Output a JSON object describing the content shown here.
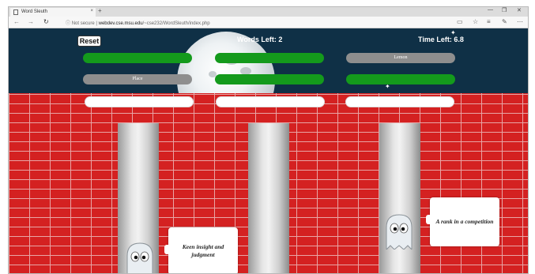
{
  "browser": {
    "tab_title": "Word Sleuth",
    "tab_close": "×",
    "new_tab": "+",
    "nav_back": "←",
    "nav_forward": "→",
    "nav_reload": "↻",
    "security": "Not secure",
    "address_host": "webdev.cse.msu.edu",
    "address_path": "/~cse232/WordSleuth/index.php",
    "window_minimize": "—",
    "window_restore": "❐",
    "window_close": "✕"
  },
  "game": {
    "reset_label": "Reset",
    "words_left_label": "Words Left: 2",
    "time_left_label": "Time Left: 6.8",
    "word_slots": [
      {
        "label": "",
        "state": "green"
      },
      {
        "label": "",
        "state": "green"
      },
      {
        "label": "Lemon",
        "state": "grey"
      },
      {
        "label": "Place",
        "state": "grey"
      },
      {
        "label": "",
        "state": "green"
      },
      {
        "label": "",
        "state": "green"
      }
    ],
    "clue_cards": [
      {
        "text": "Keen insight and judgment"
      },
      {
        "text": "A rank in a competition"
      }
    ],
    "colors": {
      "sky": "#0f3046",
      "brick": "#d42121",
      "slot_found": "#149a1c",
      "slot_pending": "#8e8e8e"
    }
  }
}
